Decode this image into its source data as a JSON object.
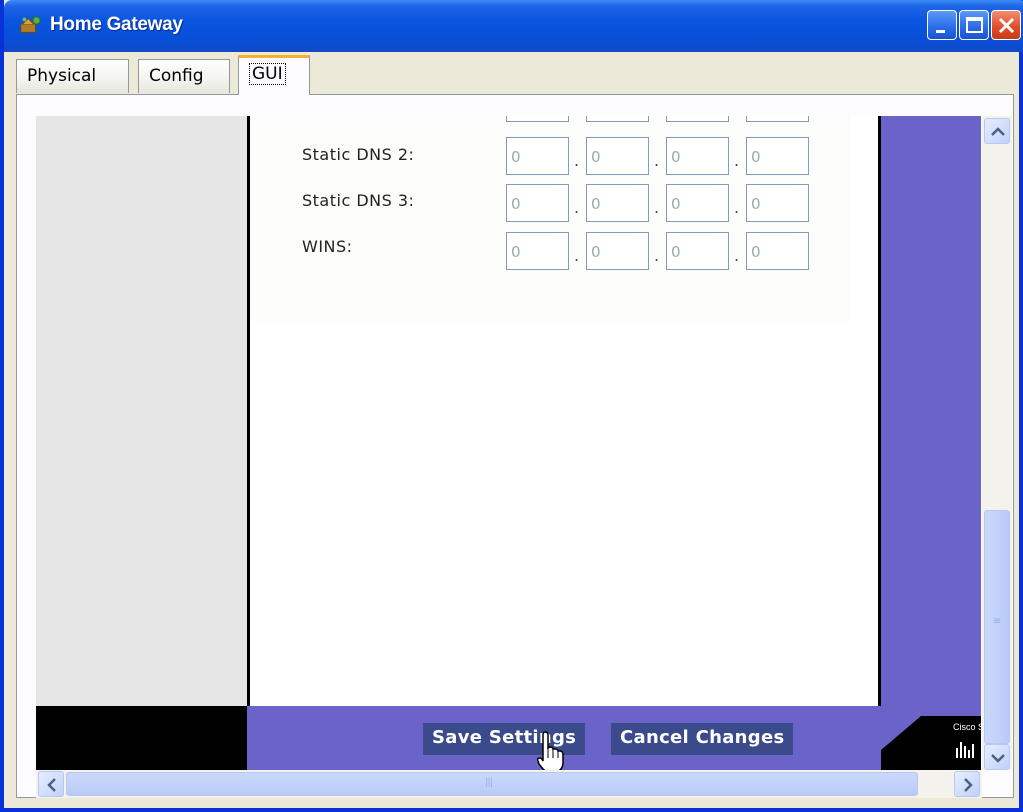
{
  "window": {
    "title": "Home Gateway",
    "accent": "#0a55e0"
  },
  "tabs": [
    {
      "label": "Physical"
    },
    {
      "label": "Config"
    },
    {
      "label": "GUI",
      "active": true
    }
  ],
  "form": {
    "rows": [
      {
        "label": "Static DNS 2:",
        "octets": [
          "0",
          "0",
          "0",
          "0"
        ]
      },
      {
        "label": "Static DNS 3:",
        "octets": [
          "0",
          "0",
          "0",
          "0"
        ]
      },
      {
        "label": "WINS:",
        "octets": [
          "0",
          "0",
          "0",
          "0"
        ]
      }
    ]
  },
  "actions": {
    "save_label": "Save Settings",
    "cancel_label": "Cancel Changes"
  },
  "logo": {
    "text": "Cisco S"
  },
  "colors": {
    "page_purple": "#6a64c8",
    "button_navy": "#3a4a8a"
  }
}
